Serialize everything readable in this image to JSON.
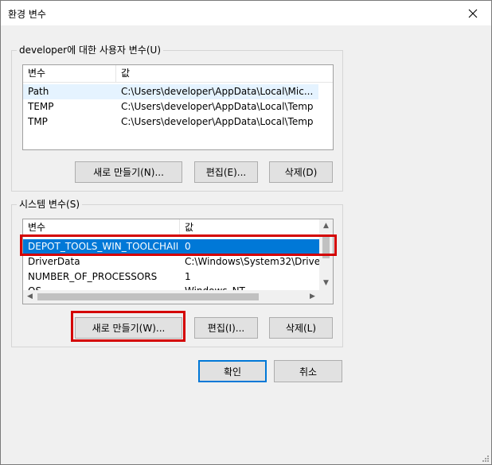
{
  "window": {
    "title": "환경 변수"
  },
  "user_group": {
    "label": "developer에 대한 사용자 변수(U)",
    "columns": [
      "변수",
      "값"
    ],
    "rows": [
      {
        "name": "Path",
        "value": "C:\\Users\\developer\\AppData\\Local\\Mic..."
      },
      {
        "name": "TEMP",
        "value": "C:\\Users\\developer\\AppData\\Local\\Temp"
      },
      {
        "name": "TMP",
        "value": "C:\\Users\\developer\\AppData\\Local\\Temp"
      }
    ],
    "buttons": {
      "new": "새로 만들기(N)...",
      "edit": "편집(E)...",
      "delete": "삭제(D)"
    }
  },
  "system_group": {
    "label": "시스템 변수(S)",
    "columns": [
      "변수",
      "값"
    ],
    "rows": [
      {
        "name": "DEPOT_TOOLS_WIN_TOOLCHAIN",
        "value": "0"
      },
      {
        "name": "DriverData",
        "value": "C:\\Windows\\System32\\Drive"
      },
      {
        "name": "NUMBER_OF_PROCESSORS",
        "value": "1"
      },
      {
        "name": "OS",
        "value": "Windows_NT"
      }
    ],
    "buttons": {
      "new": "새로 만들기(W)...",
      "edit": "편집(I)...",
      "delete": "삭제(L)"
    }
  },
  "dialog_buttons": {
    "ok": "확인",
    "cancel": "취소"
  },
  "colors": {
    "selection": "#0078d7",
    "highlight_box": "#d40000"
  }
}
